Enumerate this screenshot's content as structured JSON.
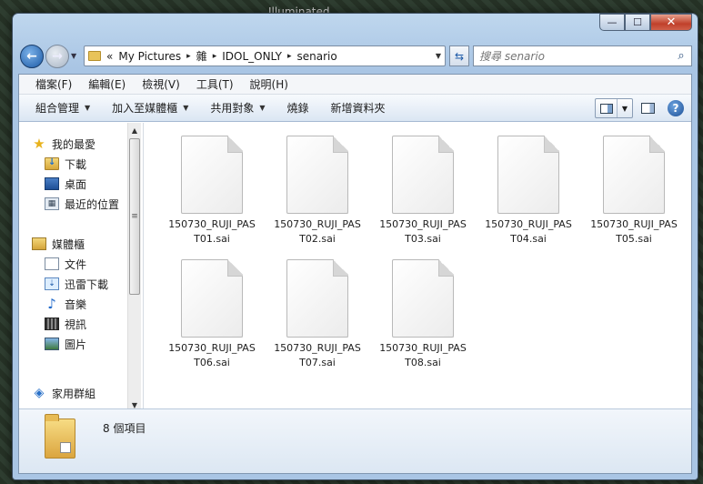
{
  "background": {
    "title": "Illuminated"
  },
  "window": {
    "controls": {
      "minimize": "—",
      "maximize": "☐",
      "close": "✕"
    }
  },
  "address_bar": {
    "overflow": "«",
    "breadcrumbs": [
      "My Pictures",
      "雜",
      "IDOL_ONLY",
      "senario"
    ],
    "separator": "▸"
  },
  "search": {
    "placeholder": "搜尋 senario"
  },
  "menubar": [
    "檔案(F)",
    "編輯(E)",
    "檢視(V)",
    "工具(T)",
    "說明(H)"
  ],
  "toolbar": {
    "organize": "組合管理",
    "add_to_library": "加入至媒體櫃",
    "share_with": "共用對象",
    "burn": "燒錄",
    "new_folder": "新增資料夾"
  },
  "nav_pane": {
    "favorites": {
      "label": "我的最愛",
      "items": [
        "下載",
        "桌面",
        "最近的位置"
      ]
    },
    "libraries": {
      "label": "媒體櫃",
      "items": [
        "文件",
        "迅雷下載",
        "音樂",
        "視訊",
        "圖片"
      ]
    },
    "homegroup": "家用群組"
  },
  "files": [
    {
      "name": "150730_RUJI_PAST01.sai",
      "icon": "file-icon"
    },
    {
      "name": "150730_RUJI_PAST02.sai",
      "icon": "file-icon"
    },
    {
      "name": "150730_RUJI_PAST03.sai",
      "icon": "file-icon"
    },
    {
      "name": "150730_RUJI_PAST04.sai",
      "icon": "file-icon"
    },
    {
      "name": "150730_RUJI_PAST05.sai",
      "icon": "file-icon"
    },
    {
      "name": "150730_RUJI_PAST06.sai",
      "icon": "file-icon"
    },
    {
      "name": "150730_RUJI_PAST07.sai",
      "icon": "file-icon"
    },
    {
      "name": "150730_RUJI_PAST08.sai",
      "icon": "file-icon"
    }
  ],
  "details": {
    "item_count": "8 個項目"
  }
}
